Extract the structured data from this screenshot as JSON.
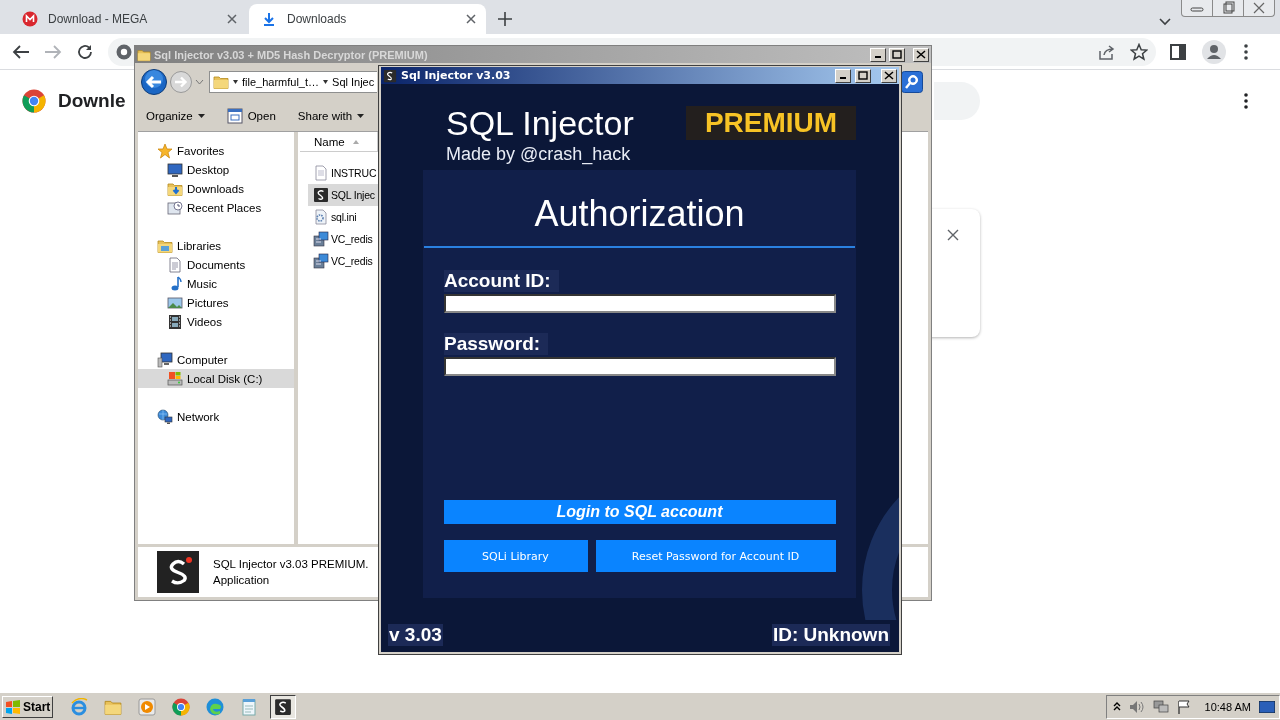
{
  "browser": {
    "tabs": [
      {
        "kind": "mega",
        "title": "Download - MEGA",
        "selected": false
      },
      {
        "kind": "download",
        "title": "Downloads",
        "selected": true
      }
    ],
    "page_heading": "Downle"
  },
  "explorer": {
    "title": "Sql Injector v3.03 + MD5 Hash Decryptor (PREMIUM)",
    "breadcrumbs": [
      "file_harmful_t…",
      "Sql Injec"
    ],
    "toolbar": [
      {
        "label": "Organize",
        "kind": "menu"
      },
      {
        "label": "Open",
        "kind": "open"
      },
      {
        "label": "Share with",
        "kind": "menu"
      }
    ],
    "nav": [
      {
        "label": "Favorites",
        "kind": "favorites",
        "selected": false,
        "children": [
          {
            "label": "Desktop",
            "kind": "desktop",
            "selected": false
          },
          {
            "label": "Downloads",
            "kind": "downloads",
            "selected": false
          },
          {
            "label": "Recent Places",
            "kind": "recent",
            "selected": false
          }
        ]
      },
      {
        "label": "Libraries",
        "kind": "libraries",
        "selected": false,
        "children": [
          {
            "label": "Documents",
            "kind": "documents",
            "selected": false
          },
          {
            "label": "Music",
            "kind": "music",
            "selected": false
          },
          {
            "label": "Pictures",
            "kind": "pictures",
            "selected": false
          },
          {
            "label": "Videos",
            "kind": "videos",
            "selected": false
          }
        ]
      },
      {
        "label": "Computer",
        "kind": "computer",
        "selected": false,
        "children": [
          {
            "label": "Local Disk (C:)",
            "kind": "disk",
            "selected": true
          }
        ]
      },
      {
        "label": "Network",
        "kind": "network",
        "selected": false
      }
    ],
    "column": "Name",
    "files": [
      {
        "name": "INSTRUC",
        "kind": "text",
        "selected": false
      },
      {
        "name": "SQL Injec",
        "kind": "app",
        "selected": true
      },
      {
        "name": "sql.ini",
        "kind": "settings",
        "selected": false
      },
      {
        "name": "VC_redis",
        "kind": "installer",
        "selected": false
      },
      {
        "name": "VC_redis",
        "kind": "installer",
        "selected": false
      }
    ],
    "details": {
      "name": "SQL Injector v3.03 PREMIUM.",
      "type": "Application"
    }
  },
  "injector": {
    "title": "Sql Injector v3.03",
    "app_name": "SQL Injector",
    "byline": "Made by @crash_hack",
    "badge": "PREMIUM",
    "heading": "Authorization",
    "fields": [
      {
        "label": "Account ID:"
      },
      {
        "label": "Password:"
      }
    ],
    "login_button": "Login to SQL account",
    "buttons": [
      "SQLi Library",
      "Reset Password for Account ID"
    ],
    "version": "v 3.03",
    "id_status": "ID: Unknown"
  },
  "taskbar": {
    "start": "Start",
    "apps": [
      {
        "kind": "ie",
        "selected": false
      },
      {
        "kind": "folder",
        "selected": false
      },
      {
        "kind": "media",
        "selected": false
      },
      {
        "kind": "chrome",
        "selected": false
      },
      {
        "kind": "edge",
        "selected": false
      },
      {
        "kind": "notepad",
        "selected": false
      },
      {
        "kind": "app",
        "selected": true
      }
    ],
    "clock": "10:48 AM"
  }
}
